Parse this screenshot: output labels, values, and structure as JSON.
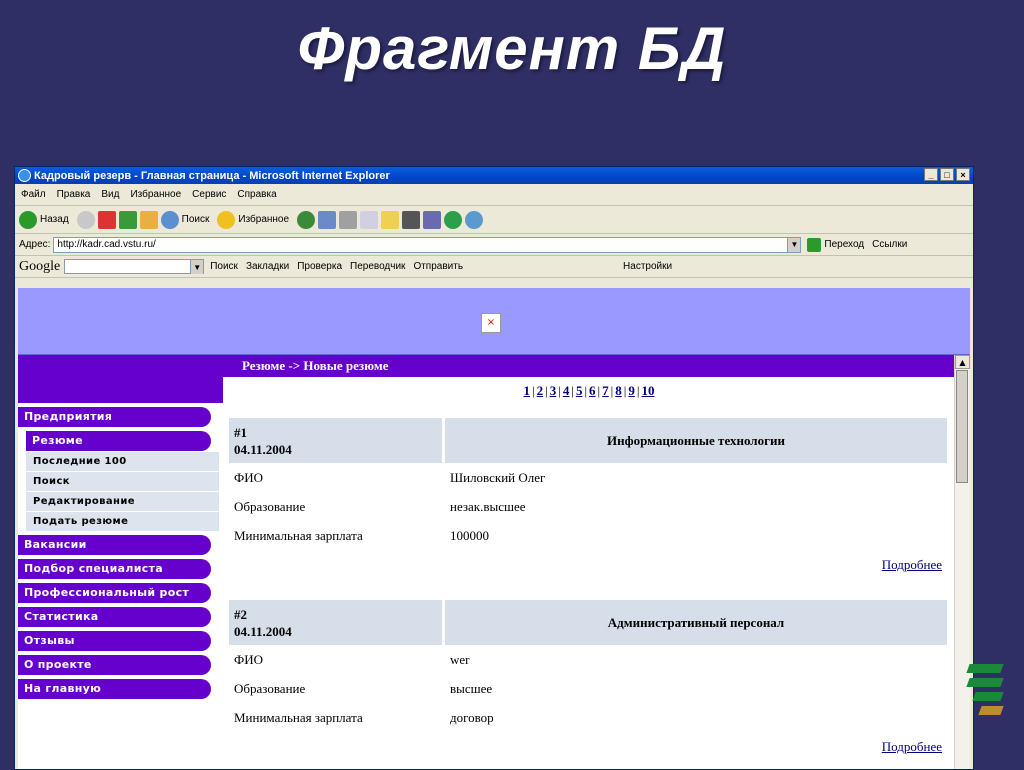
{
  "slide": {
    "title": "Фрагмент БД"
  },
  "window": {
    "title": "Кадровый резерв - Главная страница - Microsoft Internet Explorer",
    "buttons": [
      "_",
      "□",
      "×"
    ]
  },
  "menu": {
    "items": [
      "Файл",
      "Правка",
      "Вид",
      "Избранное",
      "Сервис",
      "Справка"
    ]
  },
  "toolbar": {
    "back": "Назад",
    "search": "Поиск",
    "favorites": "Избранное"
  },
  "address": {
    "label": "Адрес:",
    "url": "http://kadr.cad.vstu.ru/",
    "go": "Переход",
    "links": "Ссылки"
  },
  "google": {
    "logo": "Google",
    "search": "Поиск",
    "bookmarks": "Закладки",
    "check": "Проверка",
    "translate": "Переводчик",
    "send": "Отправить",
    "settings": "Настройки"
  },
  "sidebar": {
    "items": [
      {
        "label": "Предприятия"
      },
      {
        "label": "Резюме"
      },
      {
        "label": "Вакансии"
      },
      {
        "label": "Подбор специалиста"
      },
      {
        "label": "Профессиональный рост"
      },
      {
        "label": "Статистика"
      },
      {
        "label": "Отзывы"
      },
      {
        "label": "О проекте"
      },
      {
        "label": "На главную"
      }
    ],
    "subitems": [
      "Последние 100",
      "Поиск",
      "Редактирование",
      "Подать резюме"
    ]
  },
  "main": {
    "header": "Резюме -> Новые резюме",
    "pages": [
      "1",
      "2",
      "3",
      "4",
      "5",
      "6",
      "7",
      "8",
      "9",
      "10"
    ],
    "field_labels": {
      "fio": "ФИО",
      "education": "Образование",
      "salary": "Минимальная зарплата"
    },
    "more_label": "Подробнее",
    "resumes": [
      {
        "num": "#1",
        "date": "04.11.2004",
        "category": "Информационные технологии",
        "fio": "Шиловский Олег",
        "education": "незак.высшее",
        "salary": "100000"
      },
      {
        "num": "#2",
        "date": "04.11.2004",
        "category": "Административный персонал",
        "fio": "wer",
        "education": "высшее",
        "salary": "договор"
      }
    ]
  },
  "colors": {
    "accent": "#6600cc",
    "banner": "#9999ff",
    "card_head": "#d6dfe9",
    "slide_bg": "#2f2f66"
  }
}
